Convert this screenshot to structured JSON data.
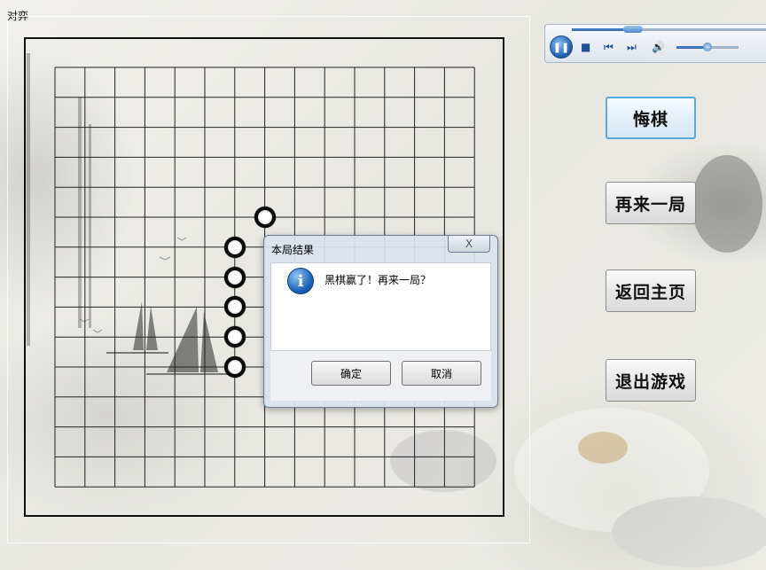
{
  "window": {
    "title": "对弈"
  },
  "board": {
    "size": 15,
    "line_color": "#222222"
  },
  "stones": [
    {
      "color": "white",
      "col": 7,
      "row": 5
    },
    {
      "color": "white",
      "col": 6,
      "row": 6
    },
    {
      "color": "white",
      "col": 6,
      "row": 7
    },
    {
      "color": "white",
      "col": 6,
      "row": 8
    },
    {
      "color": "white",
      "col": 6,
      "row": 9
    },
    {
      "color": "white",
      "col": 6,
      "row": 10
    }
  ],
  "player": {
    "seek_progress": 0.3,
    "volume": 0.5,
    "icons": [
      "pause-icon",
      "stop-icon",
      "previous-icon",
      "next-icon",
      "volume-icon"
    ]
  },
  "buttons": {
    "undo": "悔棋",
    "restart": "再来一局",
    "home": "返回主页",
    "exit": "退出游戏"
  },
  "dialog": {
    "title": "本局结果",
    "close_symbol": "X",
    "message": "黑棋赢了！再来一局？",
    "ok": "确定",
    "cancel": "取消"
  }
}
